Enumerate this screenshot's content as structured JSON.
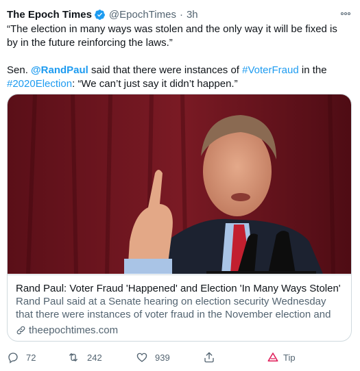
{
  "header": {
    "name": "The Epoch Times",
    "handle": "@EpochTimes",
    "dot": "·",
    "time": "3h"
  },
  "tweet": {
    "line1": "“The election in many ways was stolen and the only way it will be fixed is by in the future reinforcing the laws.”",
    "sen": "Sen. ",
    "mention": "@RandPaul",
    "said": " said that there were instances of ",
    "hashtag1": "#VoterFraud",
    "in_the": " in the ",
    "hashtag2": "#2020Election",
    "quote": ": “We can’t just say it didn’t happen.”"
  },
  "card": {
    "title": "Rand Paul: Voter Fraud 'Happened' and Election 'In Many Ways Stolen'",
    "description": "Rand Paul said at a Senate hearing on election security Wednesday that there were instances of voter fraud in the November election and that it...",
    "domain": "theepochtimes.com"
  },
  "actions": {
    "replies": "72",
    "retweets": "242",
    "likes": "939",
    "tip": "Tip"
  },
  "colors": {
    "link": "#1d9bf0",
    "verified": "#1d9bf0",
    "muted": "#536471",
    "tip_icon": "#e0245e"
  }
}
